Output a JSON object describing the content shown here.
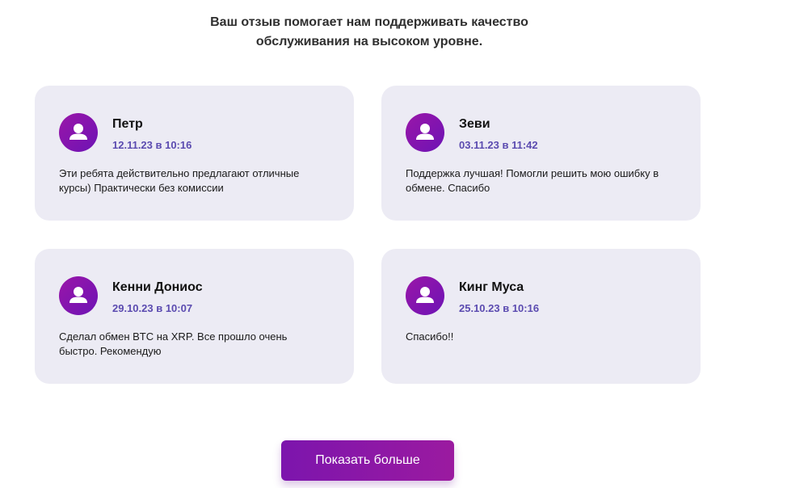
{
  "intro": {
    "text": "Ваш отзыв помогает нам поддерживать качество обслуживания на высоком уровне."
  },
  "reviews": [
    {
      "name": "Петр",
      "date": "12.11.23 в 10:16",
      "text": "Эти ребята действительно предлагают отличные курсы) Практически без комиссии",
      "avatar_icon": "user-icon"
    },
    {
      "name": "Зеви",
      "date": "03.11.23 в 11:42",
      "text": "Поддержка лучшая! Помогли решить мою ошибку в обмене. Спасибо",
      "avatar_icon": "user-icon"
    },
    {
      "name": "Кенни Дониос",
      "date": "29.10.23 в 10:07",
      "text": "Сделал обмен BTC на XRP. Все прошло очень быстро. Рекомендую",
      "avatar_icon": "user-icon"
    },
    {
      "name": "Кинг Муса",
      "date": "25.10.23 в 10:16",
      "text": "Спасибо!!",
      "avatar_icon": "user-icon"
    }
  ],
  "show_more": {
    "label": "Показать больше"
  },
  "colors": {
    "card_bg": "#ecebf4",
    "accent": "#8a17a8",
    "date": "#5b4bb0"
  }
}
